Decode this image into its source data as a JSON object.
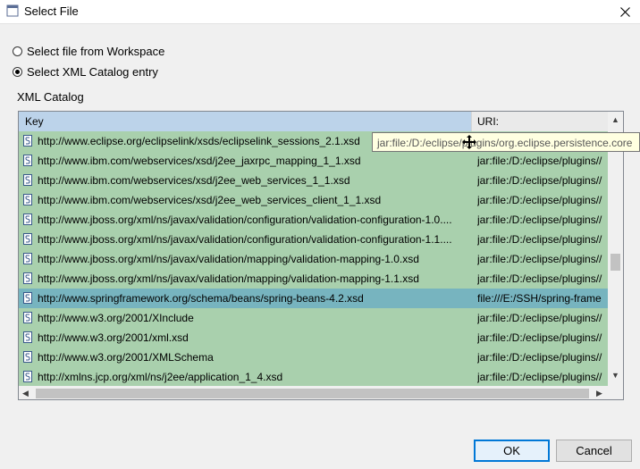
{
  "window": {
    "title": "Select File"
  },
  "options": {
    "workspace_label": "Select file from Workspace",
    "catalog_label": "Select XML Catalog entry",
    "selected": "catalog"
  },
  "catalog": {
    "group_label": "XML Catalog",
    "columns": {
      "key": "Key",
      "uri": "URI:"
    },
    "rows": [
      {
        "key": "http://www.eclipse.org/eclipselink/xsds/eclipselink_sessions_2.1.xsd",
        "uri": ""
      },
      {
        "key": "http://www.ibm.com/webservices/xsd/j2ee_jaxrpc_mapping_1_1.xsd",
        "uri": "jar:file:/D:/eclipse/plugins//"
      },
      {
        "key": "http://www.ibm.com/webservices/xsd/j2ee_web_services_1_1.xsd",
        "uri": "jar:file:/D:/eclipse/plugins//"
      },
      {
        "key": "http://www.ibm.com/webservices/xsd/j2ee_web_services_client_1_1.xsd",
        "uri": "jar:file:/D:/eclipse/plugins//"
      },
      {
        "key": "http://www.jboss.org/xml/ns/javax/validation/configuration/validation-configuration-1.0....",
        "uri": "jar:file:/D:/eclipse/plugins//"
      },
      {
        "key": "http://www.jboss.org/xml/ns/javax/validation/configuration/validation-configuration-1.1....",
        "uri": "jar:file:/D:/eclipse/plugins//"
      },
      {
        "key": "http://www.jboss.org/xml/ns/javax/validation/mapping/validation-mapping-1.0.xsd",
        "uri": "jar:file:/D:/eclipse/plugins//"
      },
      {
        "key": "http://www.jboss.org/xml/ns/javax/validation/mapping/validation-mapping-1.1.xsd",
        "uri": "jar:file:/D:/eclipse/plugins//"
      },
      {
        "key": "http://www.springframework.org/schema/beans/spring-beans-4.2.xsd",
        "uri": "file:///E:/SSH/spring-frame",
        "selected": true
      },
      {
        "key": "http://www.w3.org/2001/XInclude",
        "uri": "jar:file:/D:/eclipse/plugins//"
      },
      {
        "key": "http://www.w3.org/2001/xml.xsd",
        "uri": "jar:file:/D:/eclipse/plugins//"
      },
      {
        "key": "http://www.w3.org/2001/XMLSchema",
        "uri": "jar:file:/D:/eclipse/plugins//"
      },
      {
        "key": "http://xmlns.jcp.org/xml/ns/j2ee/application_1_4.xsd",
        "uri": "jar:file:/D:/eclipse/plugins//"
      }
    ],
    "tooltip": "jar:file:/D:/eclipse/plugins/org.eclipse.persistence.core"
  },
  "buttons": {
    "ok": "OK",
    "cancel": "Cancel"
  },
  "icons": {
    "app": "eclipse-app-icon",
    "close": "close-icon",
    "row": "schema-file-icon",
    "scroll_up": "scroll-up-arrow-icon",
    "scroll_down": "scroll-down-arrow-icon",
    "scroll_left": "scroll-left-arrow-icon",
    "scroll_right": "scroll-right-arrow-icon",
    "cursor": "move-cursor-icon"
  },
  "colors": {
    "row_bg": "#a9d0ad",
    "selected_row_bg": "#77b4bf",
    "key_header_bg": "#bcd3ea",
    "ok_border": "#0078d7"
  }
}
